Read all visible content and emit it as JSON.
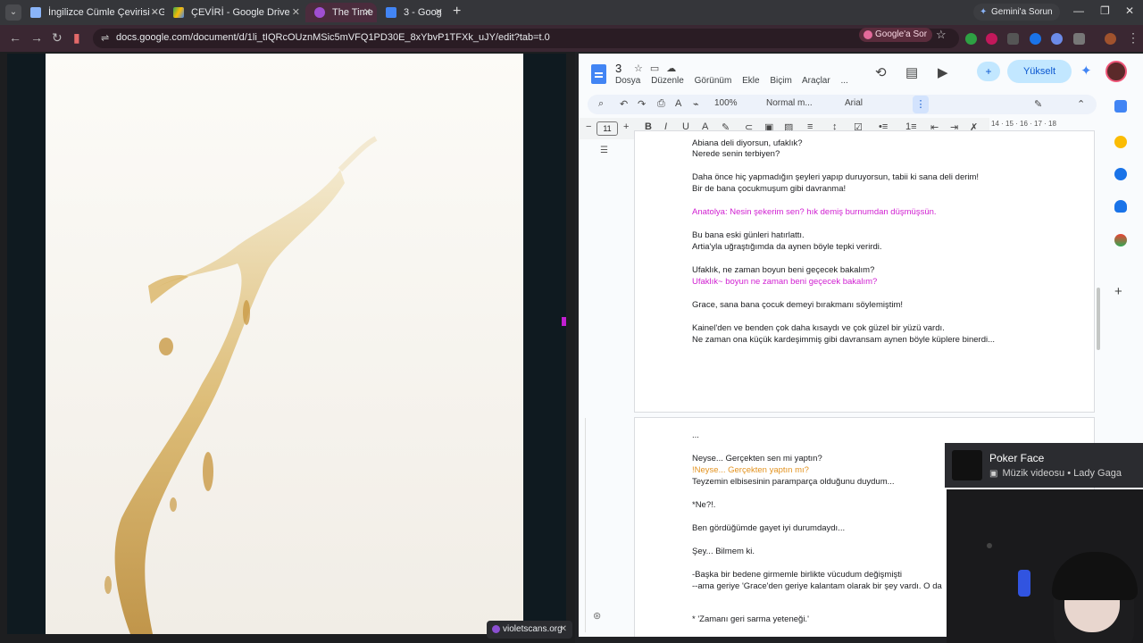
{
  "tabs": [
    {
      "title": "İngilizce Cümle Çevirisi - Goog",
      "active": false
    },
    {
      "title": "ÇEVİRİ - Google Drive",
      "active": false
    },
    {
      "title": "The Time",
      "active": true
    },
    {
      "title": "3 - Goog",
      "active": false
    }
  ],
  "gemini_button": "Gemini'a Sorun",
  "url": "docs.google.com/document/d/1li_tIQRcOUznMSic5mVFQ1PD30E_8xYbvP1TFXk_uJY/edit?tab=t.0",
  "google_ask": "Google'a Sor",
  "violet_tab": "violetscans.org",
  "docs": {
    "title": "3",
    "menus": [
      "Dosya",
      "Düzenle",
      "Görünüm",
      "Ekle",
      "Biçim",
      "Araçlar",
      "..."
    ],
    "upgrade": "Yükselt",
    "zoom": "100%",
    "style": "Normal m...",
    "font": "Arial",
    "font_size": "11",
    "ruler_ticks": "14 · 15 · 16 · 17 · 18"
  },
  "page1_lines": [
    {
      "text": "Abiana deli diyorsun, ufaklık?",
      "cls": ""
    },
    {
      "text": "Nerede senin terbiyen?",
      "cls": ""
    },
    {
      "text": "Daha önce hiç yapmadığın şeyleri yapıp duruyorsun, tabii ki sana deli derim!",
      "cls": ""
    },
    {
      "text": "Bir de bana çocukmuşum gibi davranma!",
      "cls": ""
    },
    {
      "text": "Anatolya: Nesin şekerim sen? hık demiş burnumdan düşmüşsün.",
      "cls": "pink"
    },
    {
      "text": "Bu bana eski günleri hatırlattı.",
      "cls": ""
    },
    {
      "text": "Artia'yla uğraştığımda da aynen böyle tepki verirdi.",
      "cls": ""
    },
    {
      "text": "Ufaklık, ne zaman boyun beni geçecek bakalım?",
      "cls": ""
    },
    {
      "text": "Ufaklık~ boyun ne zaman beni geçecek bakalım?",
      "cls": "pink"
    },
    {
      "text": "Grace, sana bana çocuk demeyi bırakmanı söylemiştim!",
      "cls": ""
    },
    {
      "text": "Kainel'den ve benden çok daha kısaydı ve çok güzel bir yüzü vardı.",
      "cls": ""
    },
    {
      "text": "Ne zaman ona küçük kardeşimmiş gibi davransam aynen böyle küplere binerdi...",
      "cls": ""
    }
  ],
  "page2_lines": [
    {
      "text": "...",
      "cls": ""
    },
    {
      "text": "Neyse... Gerçekten sen mi yaptın?",
      "cls": ""
    },
    {
      "text": "!Neyse... Gerçekten yaptın mı?",
      "cls": "orange"
    },
    {
      "text": "Teyzemin elbisesinin paramparça olduğunu duydum...",
      "cls": ""
    },
    {
      "text": "*Ne?!.",
      "cls": ""
    },
    {
      "text": "Ben gördüğümde gayet iyi durumdaydı...",
      "cls": ""
    },
    {
      "text": "Şey... Bilmem ki.",
      "cls": ""
    },
    {
      "text": "-Başka bir bedene girmemle birlikte vücudum değişmişti",
      "cls": ""
    },
    {
      "text": "--ama geriye 'Grace'den geriye kalantam olarak bir şey vardı. O da",
      "cls": ""
    },
    {
      "text": "* 'Zamanı geri sarma yeteneği.'",
      "cls": ""
    }
  ],
  "media": {
    "title": "Poker Face",
    "subtitle": "Müzik videosu • Lady Gaga"
  }
}
